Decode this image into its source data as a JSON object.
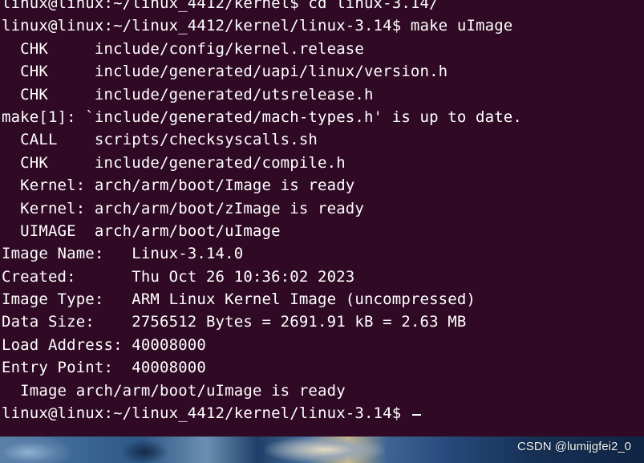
{
  "terminal": {
    "background": "#300a24",
    "foreground": "#ffffff",
    "lines": [
      "linux@linux:~/linux_4412/kernel$ cd linux-3.14/",
      "linux@linux:~/linux_4412/kernel/linux-3.14$ make uImage",
      "  CHK     include/config/kernel.release",
      "  CHK     include/generated/uapi/linux/version.h",
      "  CHK     include/generated/utsrelease.h",
      "make[1]: `include/generated/mach-types.h' is up to date.",
      "  CALL    scripts/checksyscalls.sh",
      "  CHK     include/generated/compile.h",
      "  Kernel: arch/arm/boot/Image is ready",
      "  Kernel: arch/arm/boot/zImage is ready",
      "  UIMAGE  arch/arm/boot/uImage",
      "Image Name:   Linux-3.14.0",
      "Created:      Thu Oct 26 10:36:02 2023",
      "Image Type:   ARM Linux Kernel Image (uncompressed)",
      "Data Size:    2756512 Bytes = 2691.91 kB = 2.63 MB",
      "Load Address: 40008000",
      "Entry Point:  40008000",
      "  Image arch/arm/boot/uImage is ready"
    ],
    "prompt": "linux@linux:~/linux_4412/kernel/linux-3.14$ "
  },
  "watermark": "CSDN @lumijgfei2_0"
}
